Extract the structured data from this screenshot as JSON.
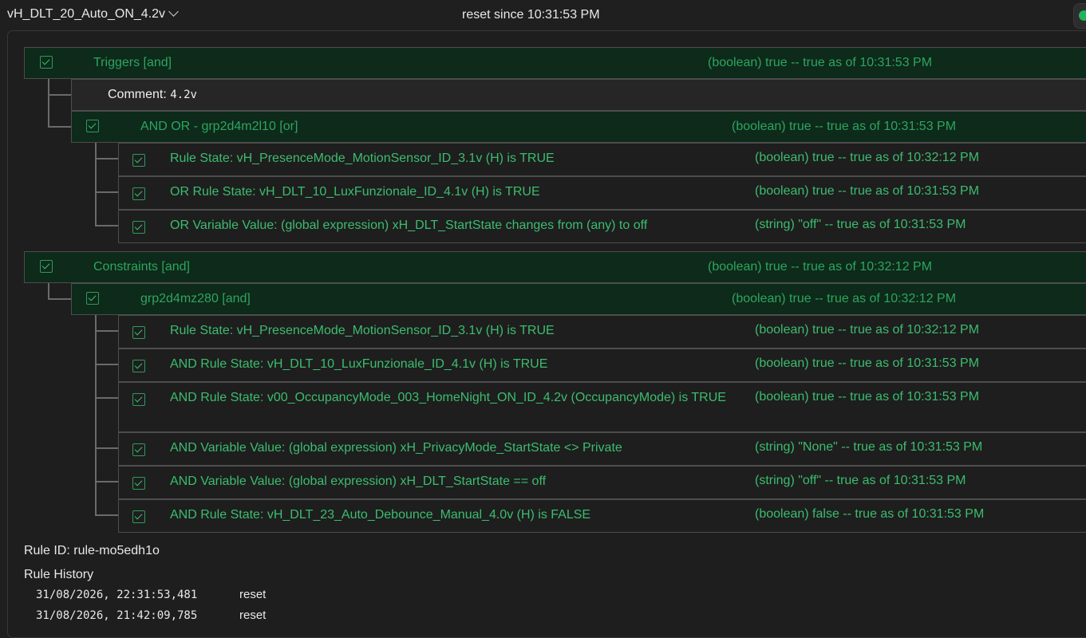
{
  "header": {
    "rule_name": "vH_DLT_20_Auto_ON_4.2v",
    "reset_since": "reset since 10:31:53 PM",
    "status_color": "#23b35c"
  },
  "triggers": {
    "label": "Triggers [and]",
    "value": "(boolean) true -- true as of 10:31:53 PM",
    "comment_label": "Comment:",
    "comment_value": "4.2v",
    "group": {
      "label": "AND OR - grp2d4m2l10 [or]",
      "value": "(boolean) true -- true as of 10:31:53 PM",
      "items": [
        {
          "label": "Rule State: vH_PresenceMode_MotionSensor_ID_3.1v (H) is TRUE",
          "value": "(boolean) true -- true as of 10:32:12 PM"
        },
        {
          "label": "OR Rule State: vH_DLT_10_LuxFunzionale_ID_4.1v (H) is TRUE",
          "value": "(boolean) true -- true as of 10:31:53 PM"
        },
        {
          "label": "OR Variable Value: (global expression) xH_DLT_StartState changes from (any) to off",
          "value": "(string) \"off\" -- true as of 10:31:53 PM"
        }
      ]
    }
  },
  "constraints": {
    "label": "Constraints [and]",
    "value": "(boolean) true -- true as of 10:32:12 PM",
    "group": {
      "label": "grp2d4mz280 [and]",
      "value": "(boolean) true -- true as of 10:32:12 PM",
      "items": [
        {
          "label": "Rule State: vH_PresenceMode_MotionSensor_ID_3.1v (H) is TRUE",
          "value": "(boolean) true -- true as of 10:32:12 PM"
        },
        {
          "label": "AND Rule State: vH_DLT_10_LuxFunzionale_ID_4.1v (H) is TRUE",
          "value": "(boolean) true -- true as of 10:31:53 PM"
        },
        {
          "label": "AND Rule State: v00_OccupancyMode_003_HomeNight_ON_ID_4.2v (OccupancyMode) is TRUE",
          "value": "(boolean) true -- true as of 10:31:53 PM"
        },
        {
          "label": "AND Variable Value: (global expression) xH_PrivacyMode_StartState <> Private",
          "value": "(string) \"None\" -- true as of 10:31:53 PM"
        },
        {
          "label": "AND Variable Value: (global expression) xH_DLT_StartState == off",
          "value": "(string) \"off\" -- true as of 10:31:53 PM"
        },
        {
          "label": "AND Rule State: vH_DLT_23_Auto_Debounce_Manual_4.0v (H) is FALSE",
          "value": "(boolean) false -- true as of 10:31:53 PM"
        }
      ]
    }
  },
  "footer": {
    "rule_id": "Rule ID: rule-mo5edh1o",
    "history_title": "Rule History",
    "history": [
      {
        "timestamp": "31/08/2026, 22:31:53,481",
        "event": "reset"
      },
      {
        "timestamp": "31/08/2026, 21:42:09,785",
        "event": "reset"
      }
    ]
  }
}
